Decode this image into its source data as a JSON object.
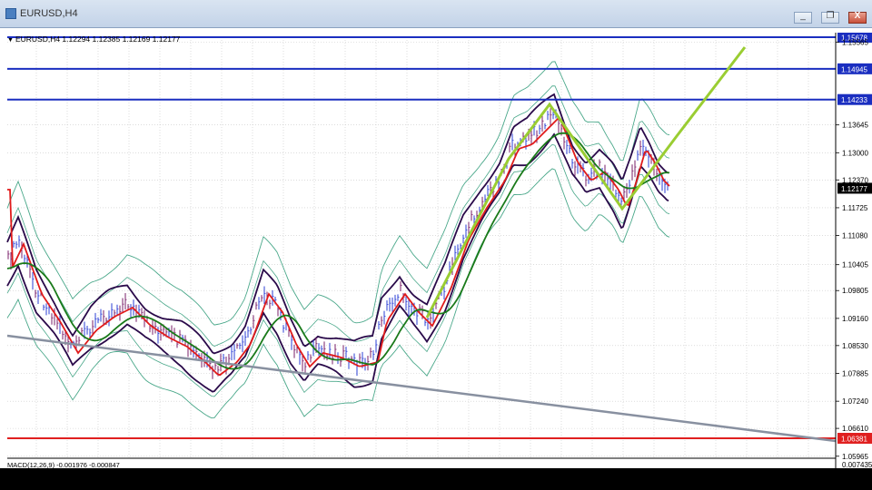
{
  "window": {
    "title": "EURUSD,H4",
    "minimize_label": "_",
    "maximize_label": "❐",
    "close_label": "X"
  },
  "chart": {
    "caption": "EURUSD,H4  1.12294 1.12385 1.12169 1.12177",
    "indicator_caption": "MACD(12,26,9) -0.001976 -0.000847",
    "price_labels": [
      {
        "text": "1.15678",
        "price": 1.15678,
        "kind": "highlight",
        "color": "#1a2ec0"
      },
      {
        "text": "1.15565",
        "price": 1.15565,
        "kind": "tick"
      },
      {
        "text": "1.14945",
        "price": 1.14945,
        "kind": "highlight",
        "color": "#1a2ec0"
      },
      {
        "text": "1.14233",
        "price": 1.14233,
        "kind": "highlight",
        "color": "#1a2ec0"
      },
      {
        "text": "1.13645",
        "price": 1.13645,
        "kind": "tick"
      },
      {
        "text": "1.13000",
        "price": 1.13,
        "kind": "tick"
      },
      {
        "text": "1.12370",
        "price": 1.1237,
        "kind": "tick"
      },
      {
        "text": "1.12177",
        "price": 1.12177,
        "kind": "highlight",
        "color": "#000000"
      },
      {
        "text": "1.11725",
        "price": 1.11725,
        "kind": "tick"
      },
      {
        "text": "1.11080",
        "price": 1.1108,
        "kind": "tick"
      },
      {
        "text": "1.10405",
        "price": 1.10405,
        "kind": "tick"
      },
      {
        "text": "1.09805",
        "price": 1.09805,
        "kind": "tick"
      },
      {
        "text": "1.09160",
        "price": 1.0916,
        "kind": "tick"
      },
      {
        "text": "1.08530",
        "price": 1.0853,
        "kind": "tick"
      },
      {
        "text": "1.07885",
        "price": 1.07885,
        "kind": "tick"
      },
      {
        "text": "1.07240",
        "price": 1.0724,
        "kind": "tick"
      },
      {
        "text": "1.06610",
        "price": 1.0661,
        "kind": "tick"
      },
      {
        "text": "1.06381",
        "price": 1.06381,
        "kind": "highlight",
        "color": "#e02020"
      },
      {
        "text": "1.05965",
        "price": 1.05965,
        "kind": "tick"
      }
    ],
    "macd_label": "0.007435",
    "horizontal_lines": [
      {
        "price": 1.15678,
        "color": "#1a2ec0"
      },
      {
        "price": 1.14945,
        "color": "#1a2ec0"
      },
      {
        "price": 1.14233,
        "color": "#1a2ec0"
      },
      {
        "price": 1.06381,
        "color": "#e02020"
      }
    ],
    "colors": {
      "bull_bar": "#2b3fd6",
      "bear_bar": "#7a1f6a",
      "ma_fast": "#e01b1b",
      "ma_slow": "#1a7a1a",
      "envelope": "#2a0a4a",
      "bands": "#4aa88a",
      "trendline_green": "#9acd32",
      "trendline_gray": "#8890a0"
    }
  }
}
